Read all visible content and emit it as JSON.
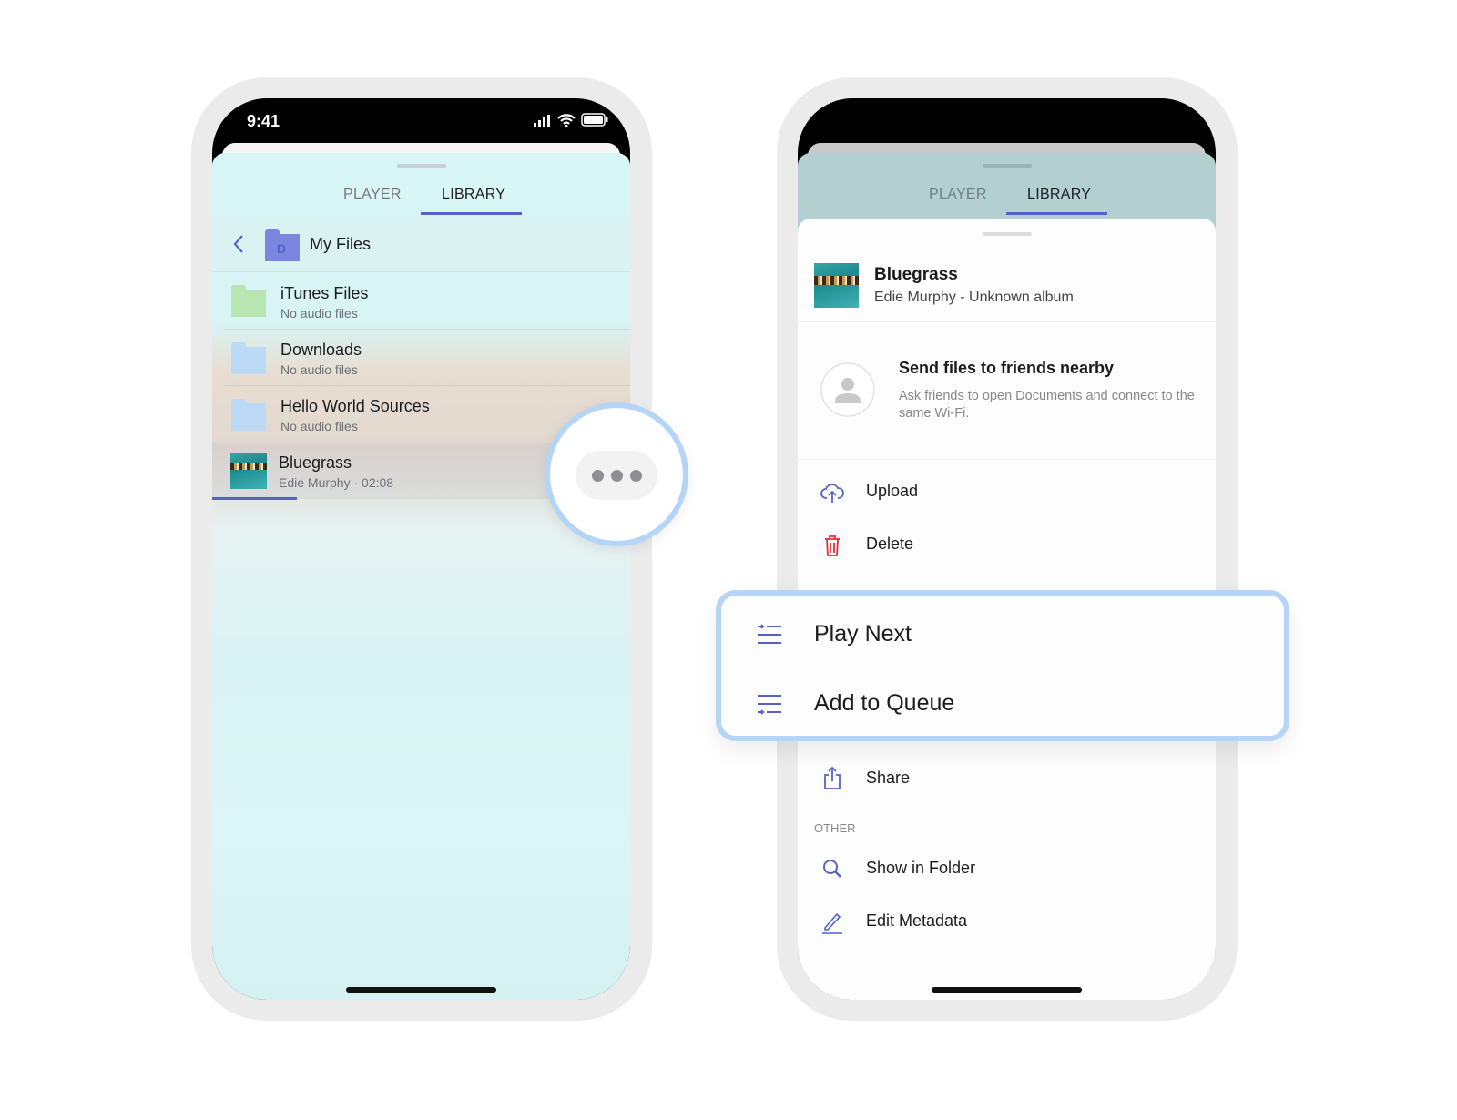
{
  "left_phone": {
    "status_bar": {
      "time": "9:41",
      "icons": [
        "signal-icon",
        "wifi-icon",
        "battery-icon"
      ]
    },
    "tabs": [
      {
        "label": "PLAYER",
        "active": false
      },
      {
        "label": "LIBRARY",
        "active": true
      }
    ],
    "header": {
      "back_icon": "chevron-left-icon",
      "title": "My Files"
    },
    "items": [
      {
        "title": "iTunes Files",
        "subtitle": "No audio files",
        "icon": "folder-green"
      },
      {
        "title": "Downloads",
        "subtitle": "No audio files",
        "icon": "folder-blue"
      },
      {
        "title": "Hello World Sources",
        "subtitle": "No audio files",
        "icon": "folder-blue"
      },
      {
        "title": "Bluegrass",
        "artist": "Edie Murphy",
        "separator": "·",
        "duration": "02:08",
        "icon": "album-art"
      }
    ],
    "more_button_icon": "more-horizontal-icon"
  },
  "right_phone": {
    "tabs": [
      {
        "label": "PLAYER",
        "active": false
      },
      {
        "label": "LIBRARY",
        "active": true
      }
    ],
    "track": {
      "title": "Bluegrass",
      "subtitle": "Edie Murphy - Unknown album"
    },
    "nearby": {
      "title": "Send files to friends nearby",
      "description": "Ask friends to open Documents and connect to the same Wi-Fi."
    },
    "actions": [
      {
        "label": "Upload",
        "icon": "cloud-upload-icon"
      },
      {
        "label": "Delete",
        "icon": "trash-icon"
      }
    ],
    "highlighted_actions": [
      {
        "label": "Play Next",
        "icon": "play-next-icon"
      },
      {
        "label": "Add to Queue",
        "icon": "add-to-queue-icon"
      }
    ],
    "share": {
      "label": "Share",
      "icon": "share-icon"
    },
    "other_section": {
      "title": "OTHER",
      "items": [
        {
          "label": "Show in Folder",
          "icon": "search-icon"
        },
        {
          "label": "Edit Metadata",
          "icon": "pencil-icon"
        }
      ]
    }
  },
  "colors": {
    "accent": "#5563c8",
    "highlight": "#b5d5f7",
    "delete": "#e0303b"
  }
}
